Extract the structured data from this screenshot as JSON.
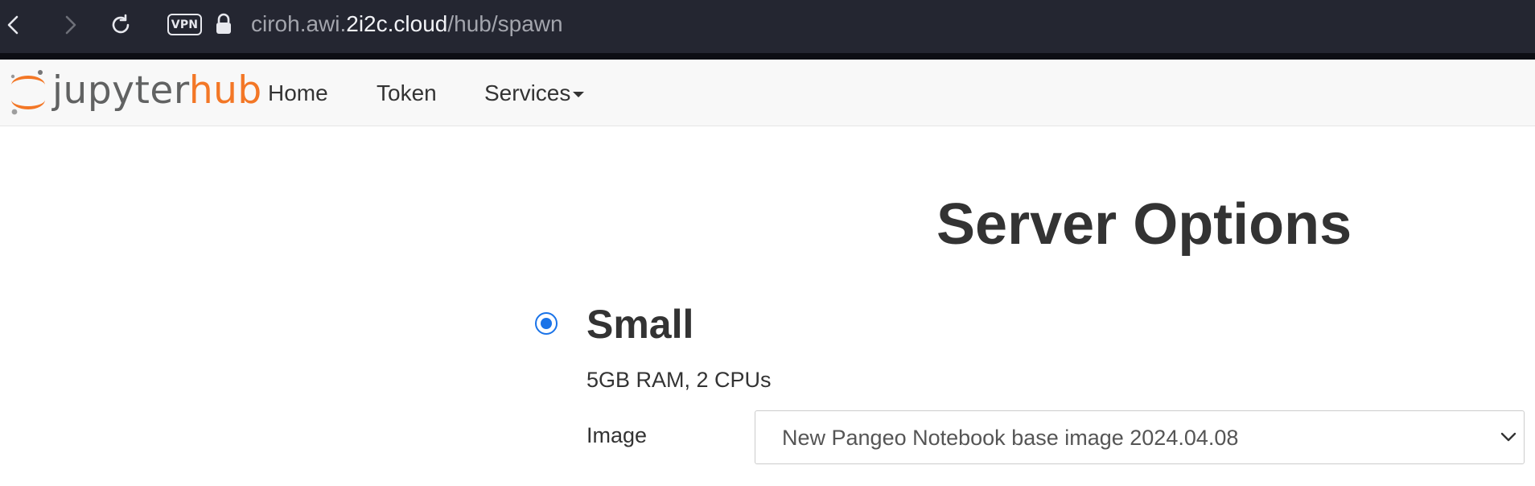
{
  "browser": {
    "vpn_label": "VPN",
    "url_prefix": "ciroh.awi.",
    "url_domain": "2i2c.cloud",
    "url_path": "/hub/spawn"
  },
  "navbar": {
    "logo_text_part1": "jupyter",
    "logo_text_part2": "hub",
    "links": [
      {
        "label": "Home"
      },
      {
        "label": "Token"
      },
      {
        "label": "Services"
      }
    ]
  },
  "main": {
    "title": "Server Options",
    "option": {
      "selected": true,
      "title": "Small",
      "description": "5GB RAM, 2 CPUs",
      "image_label": "Image",
      "image_value": "New Pangeo Notebook base image 2024.04.08"
    }
  },
  "colors": {
    "browser_bar": "#242631",
    "brand_orange": "#f37726",
    "radio_blue": "#1a73e8"
  },
  "icons": [
    "back-icon",
    "forward-icon",
    "reload-icon",
    "lock-icon",
    "chevron-down-icon"
  ]
}
